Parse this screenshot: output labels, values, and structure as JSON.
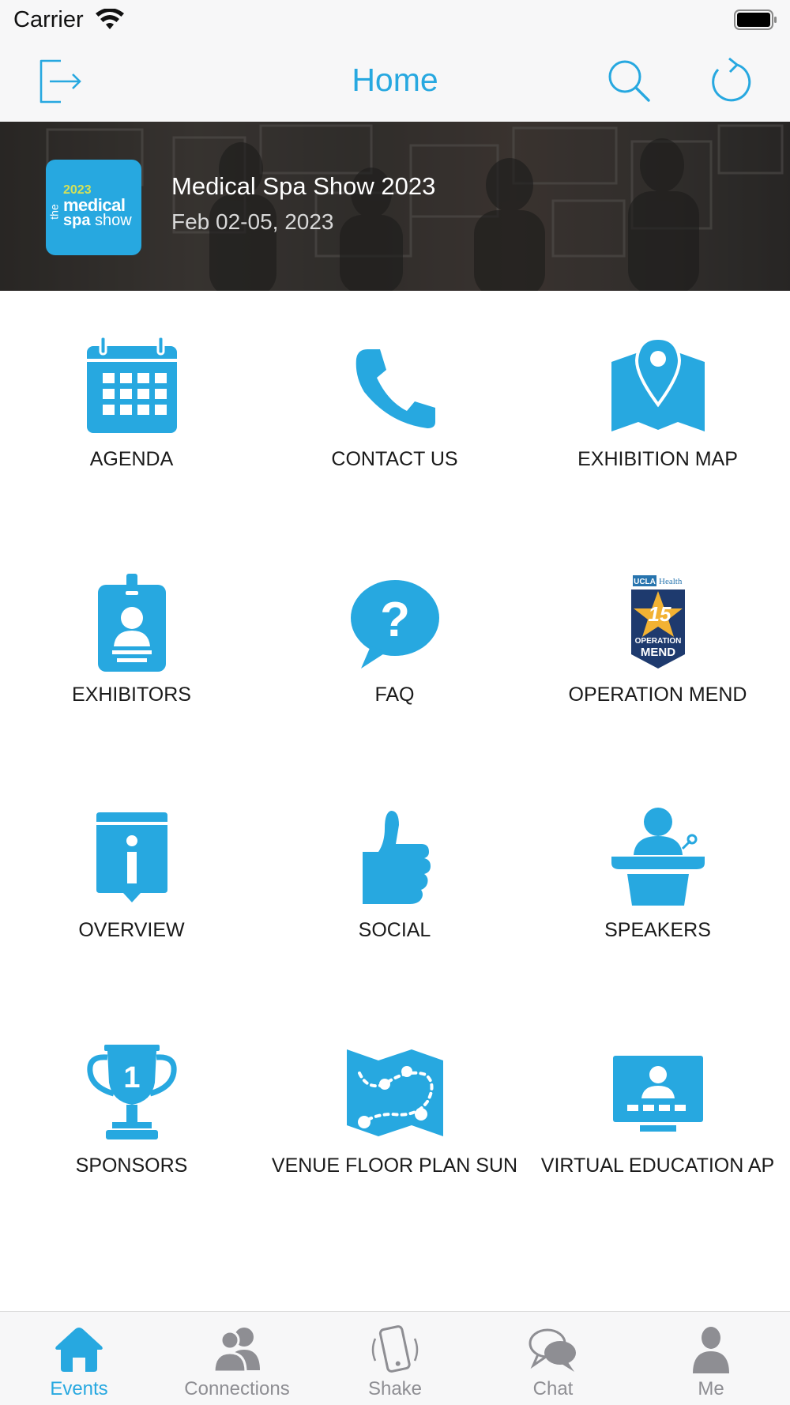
{
  "status_bar": {
    "carrier": "Carrier"
  },
  "nav": {
    "title": "Home",
    "left_icon": "logout-icon",
    "right_icons": [
      "search-icon",
      "refresh-icon"
    ]
  },
  "event": {
    "name": "Medical Spa Show 2023",
    "dates": "Feb 02-05, 2023",
    "logo": {
      "year": "2023",
      "the": "the",
      "medical": "medical",
      "spa": "spa",
      "show": "show"
    }
  },
  "grid": [
    {
      "label": "AGENDA",
      "icon": "calendar-icon"
    },
    {
      "label": "CONTACT US",
      "icon": "phone-icon"
    },
    {
      "label": "EXHIBITION MAP",
      "icon": "map-pin-icon"
    },
    {
      "label": "EXHIBITORS",
      "icon": "badge-icon"
    },
    {
      "label": "FAQ",
      "icon": "question-bubble-icon"
    },
    {
      "label": "OPERATION MEND",
      "icon": "operation-mend-logo"
    },
    {
      "label": "OVERVIEW",
      "icon": "info-icon"
    },
    {
      "label": "SOCIAL",
      "icon": "thumbs-up-icon"
    },
    {
      "label": "SPEAKERS",
      "icon": "speaker-podium-icon"
    },
    {
      "label": "SPONSORS",
      "icon": "trophy-icon"
    },
    {
      "label": "VENUE FLOOR PLAN SUN",
      "icon": "floor-plan-icon"
    },
    {
      "label": "VIRTUAL EDUCATION AP",
      "icon": "monitor-presenter-icon"
    }
  ],
  "operation_mend_logo": {
    "org": "UCLA",
    "org_suffix": "Health",
    "number": "15",
    "line1": "OPERATION",
    "line2": "MEND"
  },
  "tabs": [
    {
      "label": "Events",
      "icon": "home-icon",
      "active": true
    },
    {
      "label": "Connections",
      "icon": "people-icon",
      "active": false
    },
    {
      "label": "Shake",
      "icon": "shake-phone-icon",
      "active": false
    },
    {
      "label": "Chat",
      "icon": "chat-bubbles-icon",
      "active": false
    },
    {
      "label": "Me",
      "icon": "person-icon",
      "active": false
    }
  ],
  "colors": {
    "accent": "#27a8e0",
    "inactive": "#8e8e93",
    "bar_bg": "#f7f7f8"
  }
}
